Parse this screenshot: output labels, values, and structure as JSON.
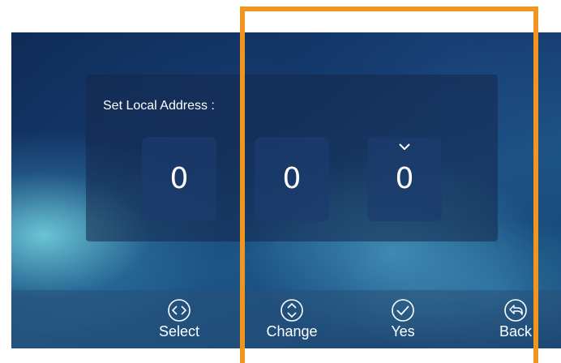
{
  "dialog": {
    "title": "Set Local Address :",
    "digits": [
      "0",
      "0",
      "0"
    ],
    "selected_digit_index": 2
  },
  "actions": [
    {
      "label": "Select",
      "icon": "left-right-arrows-circle-icon"
    },
    {
      "label": "Change",
      "icon": "up-down-arrows-circle-icon"
    },
    {
      "label": "Yes",
      "icon": "checkmark-circle-icon"
    },
    {
      "label": "Back",
      "icon": "back-arrow-circle-icon"
    }
  ],
  "colors": {
    "highlight_frame": "#f0951f",
    "text": "#ffffff",
    "digit_box": "#1c3c6e"
  }
}
